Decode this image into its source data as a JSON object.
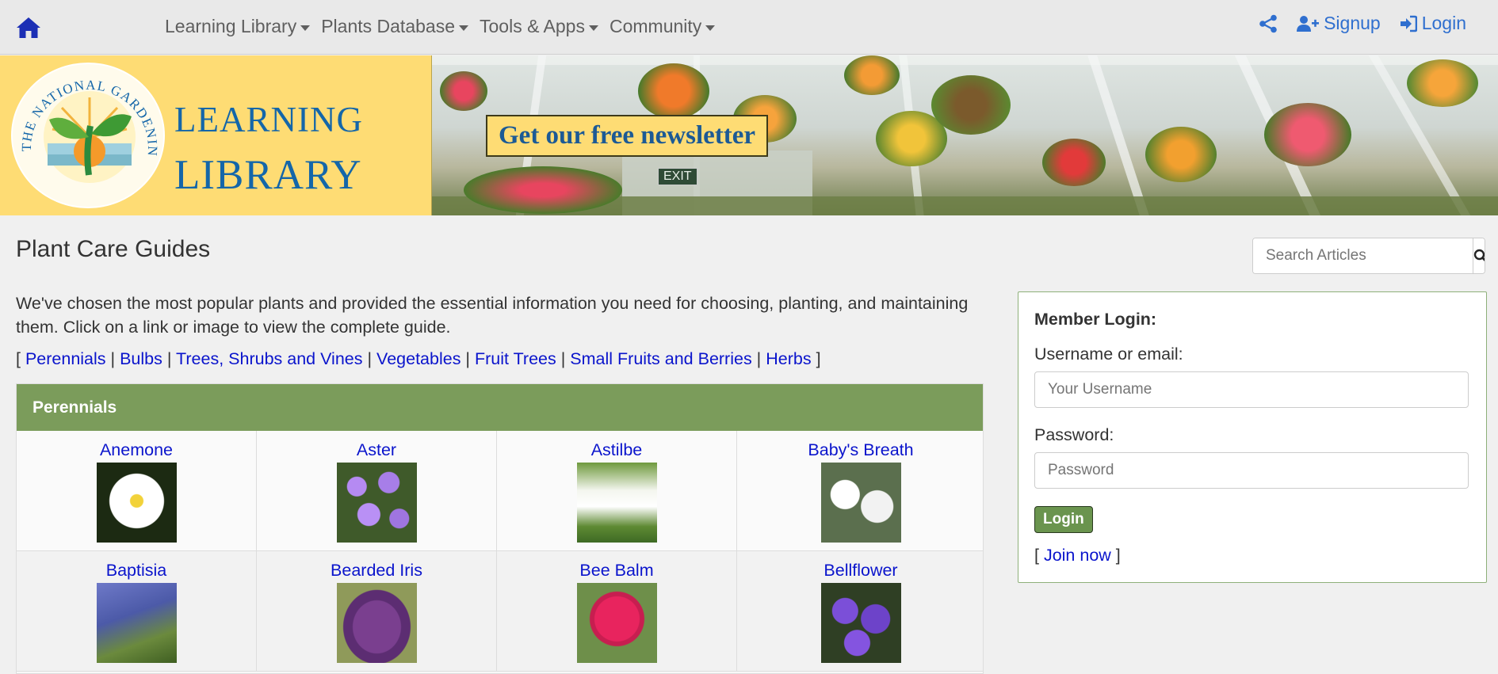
{
  "topnav": {
    "home_icon": "home-icon",
    "menu": [
      {
        "label": "Learning Library"
      },
      {
        "label": "Plants Database"
      },
      {
        "label": "Tools & Apps"
      },
      {
        "label": "Community"
      }
    ],
    "share_icon": "share-icon",
    "signup_label": "Signup",
    "login_label": "Login",
    "accent_color": "#2f6fcf"
  },
  "banner": {
    "seal_text": "THE NATIONAL GARDENING ASSOCIATION",
    "logo_line1": "Learning",
    "logo_line2": "Library",
    "newsletter_label": "Get our free newsletter",
    "exit_sign": "EXIT"
  },
  "main": {
    "title": "Plant Care Guides",
    "search_placeholder": "Search Articles",
    "intro": "We've chosen the most popular plants and provided the essential information you need for choosing, planting, and maintaining them. Click on a link or image to view the complete guide.",
    "categories": [
      {
        "label": "Perennials"
      },
      {
        "label": "Bulbs"
      },
      {
        "label": "Trees, Shrubs and Vines"
      },
      {
        "label": "Vegetables"
      },
      {
        "label": "Fruit Trees"
      },
      {
        "label": "Small Fruits and Berries"
      },
      {
        "label": "Herbs"
      }
    ],
    "panel_title": "Perennials",
    "panel_color": "#7b9c5b",
    "plants": [
      {
        "name": "Anemone"
      },
      {
        "name": "Aster"
      },
      {
        "name": "Astilbe"
      },
      {
        "name": "Baby's Breath"
      },
      {
        "name": "Baptisia"
      },
      {
        "name": "Bearded Iris"
      },
      {
        "name": "Bee Balm"
      },
      {
        "name": "Bellflower"
      }
    ]
  },
  "login": {
    "heading": "Member Login:",
    "username_label": "Username or email:",
    "username_placeholder": "Your Username",
    "password_label": "Password:",
    "password_placeholder": "Password",
    "button_label": "Login",
    "join_label": "Join now"
  }
}
